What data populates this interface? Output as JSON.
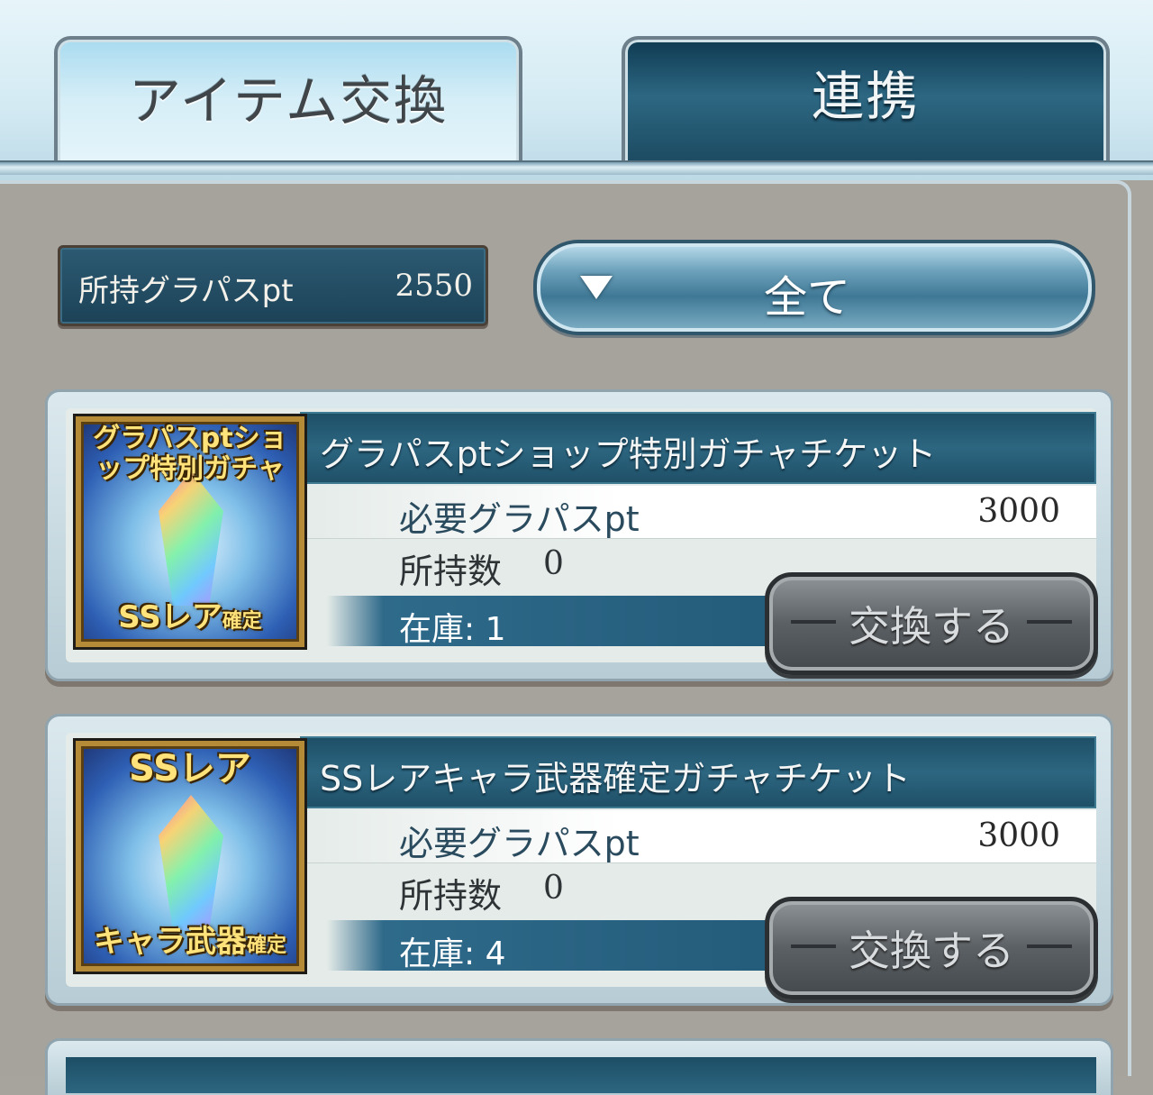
{
  "tabs": {
    "active_label": "アイテム交換",
    "inactive_label": "連携"
  },
  "points": {
    "label": "所持グラパスpt",
    "value": "2550"
  },
  "filter": {
    "label": "全て"
  },
  "items": [
    {
      "title": "グラパスptショップ特別ガチャチケット",
      "thumb_top": "グラパスptショップ特別ガチャ",
      "thumb_bottom_main": "SSレア",
      "thumb_bottom_small": "確定",
      "cost_label": "必要グラパスpt",
      "cost_value": "3000",
      "owned_label": "所持数",
      "owned_value": "0",
      "stock_label": "在庫: 1",
      "button_label": "交換する"
    },
    {
      "title": "SSレアキャラ武器確定ガチャチケット",
      "thumb_top": "SSレア",
      "thumb_bottom_main": "キャラ武器",
      "thumb_bottom_small": "確定",
      "cost_label": "必要グラパスpt",
      "cost_value": "3000",
      "owned_label": "所持数",
      "owned_value": "0",
      "stock_label": "在庫: 4",
      "button_label": "交換する"
    }
  ],
  "colors": {
    "panel_bg": "#a6a29c",
    "title_bar": "#1d4e66",
    "tab_inactive": "#1b4960",
    "button_gray": "#5b6064"
  },
  "icons": {
    "dropdown": "triangle-down-icon"
  }
}
